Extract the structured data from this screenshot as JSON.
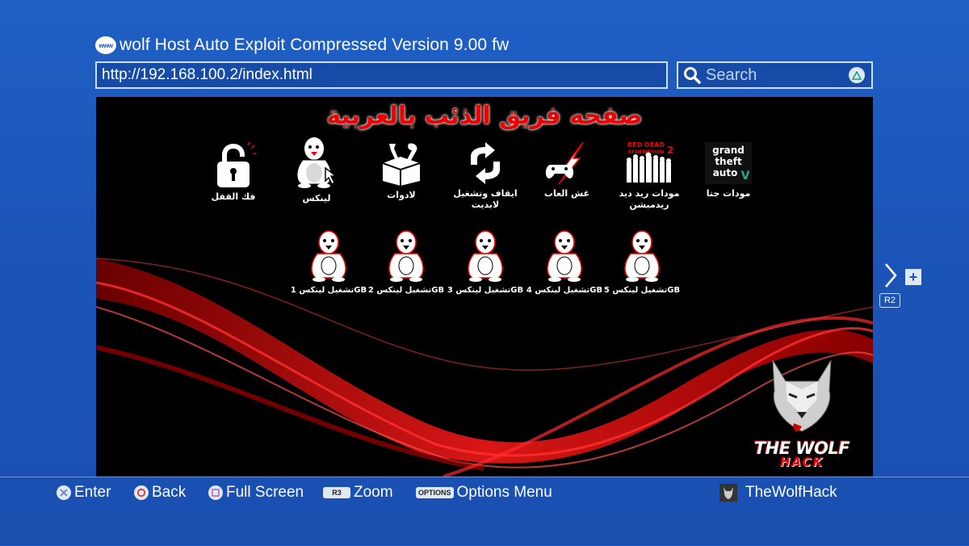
{
  "window": {
    "www_label": "www",
    "title": "wolf Host Auto Exploit Compressed Version 9.00 fw"
  },
  "address_bar": {
    "url": "http://192.168.100.2/index.html"
  },
  "search": {
    "placeholder": "Search"
  },
  "page": {
    "heading": "صفحه فريق الذئب بالعربية",
    "top_icons": [
      {
        "label": "مودات جتا"
      },
      {
        "label_line1": "مودات ريد ديد",
        "label_line2": "ريدمبشن"
      },
      {
        "label": "غش العاب"
      },
      {
        "label_line1": "ايقاف وتشغيل",
        "label_line2": "لابديت"
      },
      {
        "label": "لادوات"
      },
      {
        "label": "لينكس"
      },
      {
        "label": "فك القفل"
      }
    ],
    "linux_items": [
      {
        "label": "تشغيل لينكس 5GB"
      },
      {
        "label": "تشغيل لينكس 4GB"
      },
      {
        "label": "تشغيل لينكس 3GB"
      },
      {
        "label": "تشغيل لينكس 2GB"
      },
      {
        "label": "تشغيل لينكس 1GB"
      }
    ],
    "logo": {
      "line1": "THE WOLF",
      "line2": "HACK"
    },
    "game_logos": {
      "gta_line1": "grand",
      "gta_line2": "theft",
      "gta_line3": "auto",
      "gta_five": "V",
      "rdr_line1": "RED DEAD",
      "rdr_line2": "REDEMPTION",
      "rdr_num": "2"
    }
  },
  "side_nav": {
    "r2_label": "R2",
    "plus": "+"
  },
  "bottom_bar": {
    "enter_label": "Enter",
    "back_label": "Back",
    "fullscreen_label": "Full Screen",
    "zoom_key": "R3",
    "zoom_label": "Zoom",
    "options_key": "OPTIONS",
    "options_label": "Options Menu",
    "username": "TheWolfHack"
  },
  "colors": {
    "background": "#1b55b8",
    "accent_red": "#dd0000",
    "viewport_bg": "#000000"
  }
}
